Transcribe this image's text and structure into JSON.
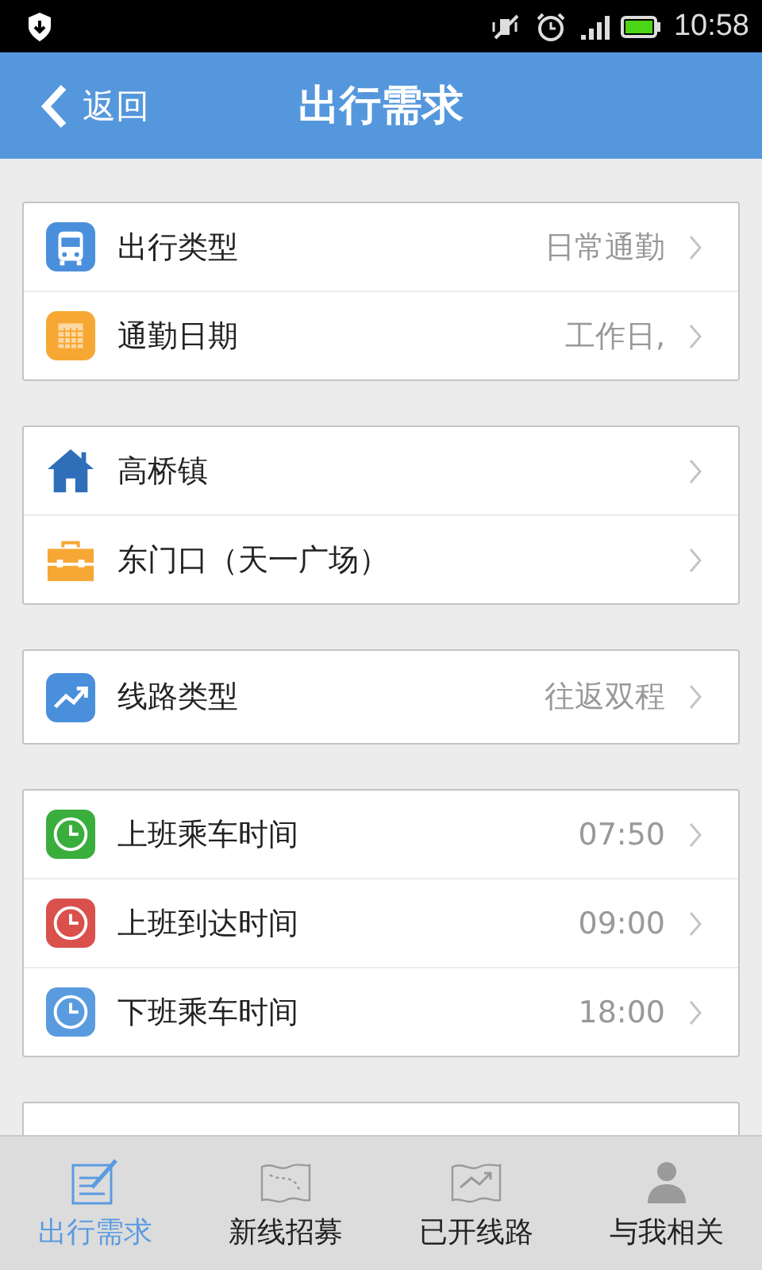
{
  "status_bar": {
    "time": "10:58"
  },
  "header": {
    "back_label": "返回",
    "title": "出行需求"
  },
  "groups": [
    {
      "rows": [
        {
          "kind": "bus",
          "label": "出行类型",
          "value": "日常通勤"
        },
        {
          "kind": "calendar",
          "label": "通勤日期",
          "value": "工作日,"
        }
      ]
    },
    {
      "rows": [
        {
          "kind": "home",
          "label": "高桥镇"
        },
        {
          "kind": "briefcase",
          "label": "东门口（天一广场）"
        }
      ]
    },
    {
      "rows": [
        {
          "kind": "trend",
          "label": "线路类型",
          "value": "往返双程"
        }
      ]
    },
    {
      "rows": [
        {
          "kind": "clock",
          "color": "#3aae3c",
          "label": "上班乘车时间",
          "value": "07:50"
        },
        {
          "kind": "clock",
          "color": "#d9504c",
          "label": "上班到达时间",
          "value": "09:00"
        },
        {
          "kind": "clock",
          "color": "#5a9be0",
          "label": "下班乘车时间",
          "value": "18:00"
        }
      ]
    }
  ],
  "tabs": [
    {
      "kind": "form",
      "label": "出行需求",
      "selected": true
    },
    {
      "kind": "map",
      "label": "新线招募",
      "selected": false
    },
    {
      "kind": "chart",
      "label": "已开线路",
      "selected": false
    },
    {
      "kind": "person",
      "label": "与我相关",
      "selected": false
    }
  ]
}
